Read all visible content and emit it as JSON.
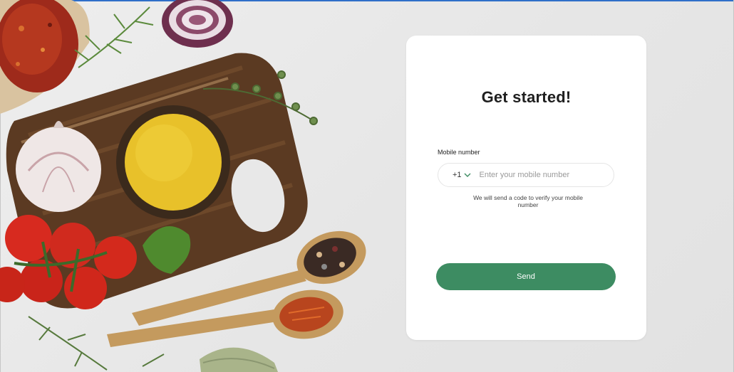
{
  "colors": {
    "accent": "#3d8c62",
    "background": "#e9e9e9",
    "card": "#ffffff",
    "title": "#1f1f1f",
    "window_border": "#2f6fc9"
  },
  "hero": {
    "icons": [
      "chili-flakes-spoon-icon",
      "onion-icon",
      "cutting-board-icon",
      "turmeric-bowl-icon",
      "garlic-icon",
      "tomatoes-icon",
      "herb-icon",
      "peppercorn-spoon-icon",
      "saffron-spoon-icon",
      "bay-leaf-icon"
    ]
  },
  "signup": {
    "title": "Get started!",
    "mobile_label": "Mobile number",
    "country_code": "+1",
    "phone_placeholder": "Enter your mobile number",
    "phone_value": "",
    "helper_text": "We will send a code to verify your mobile number",
    "send_label": "Send"
  }
}
